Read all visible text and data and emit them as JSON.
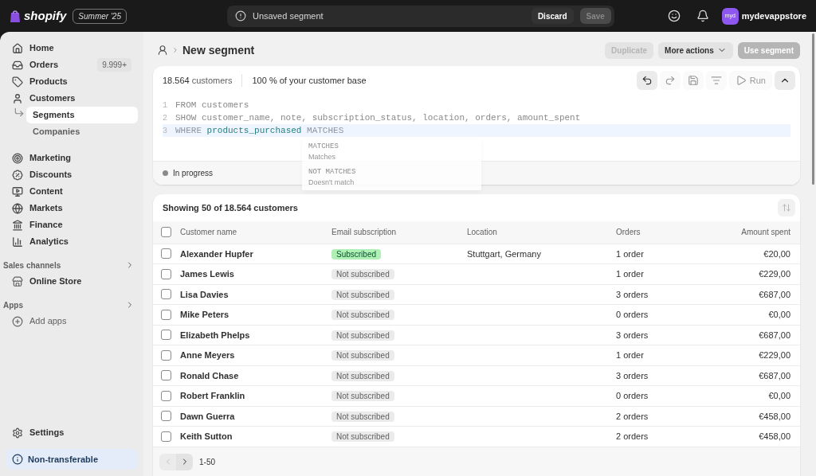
{
  "topbar": {
    "logo_text": "shopify",
    "edition_badge": "Summer '25",
    "notice": "Unsaved segment",
    "discard": "Discard",
    "save": {
      "label": "Save",
      "disabled": true
    },
    "avatar": "myd",
    "store_name": "mydevappstore"
  },
  "sidebar": {
    "items": [
      {
        "label": "Home",
        "selected": false,
        "sub": false
      },
      {
        "label": "Orders",
        "badge": "9.999+",
        "selected": false,
        "sub": false
      },
      {
        "label": "Products",
        "selected": false,
        "sub": false
      },
      {
        "label": "Customers",
        "selected": false,
        "sub": false
      },
      {
        "label": "Segments",
        "selected": true,
        "sub": true
      },
      {
        "label": "Companies",
        "selected": false,
        "sub": true
      },
      {
        "label": "Marketing",
        "selected": false,
        "sub": false
      },
      {
        "label": "Discounts",
        "selected": false,
        "sub": false
      },
      {
        "label": "Content",
        "selected": false,
        "sub": false
      },
      {
        "label": "Markets",
        "selected": false,
        "sub": false
      },
      {
        "label": "Finance",
        "selected": false,
        "sub": false
      },
      {
        "label": "Analytics",
        "selected": false,
        "sub": false
      }
    ],
    "sections": [
      {
        "title": "Sales channels",
        "items": [
          "Online Store"
        ]
      },
      {
        "title": "Apps",
        "items": [
          "Add apps"
        ]
      }
    ],
    "settings": "Settings",
    "plan_banner": "Non-transferable"
  },
  "page": {
    "title": "New segment",
    "actions": [
      {
        "label": "Duplicate",
        "disabled": true,
        "kind": "plain"
      },
      {
        "label": "More actions",
        "disabled": false,
        "kind": "menu"
      },
      {
        "label": "Use segment",
        "disabled": true,
        "kind": "primary"
      }
    ]
  },
  "editor": {
    "count_number": "18.564",
    "count_label": "customers",
    "share": "100 % of your customer base",
    "tools": [
      {
        "kind": "undo",
        "disabled": false
      },
      {
        "kind": "redo",
        "disabled": true
      },
      {
        "kind": "save",
        "disabled": true
      },
      {
        "kind": "filter",
        "disabled": true
      },
      {
        "kind": "run",
        "label": "Run",
        "disabled": true
      },
      {
        "kind": "collapse",
        "disabled": false
      }
    ],
    "lines": [
      {
        "number": "1",
        "active": false,
        "tokens": [
          {
            "text": "FROM customers",
            "kind": "plain"
          }
        ]
      },
      {
        "number": "2",
        "active": false,
        "tokens": [
          {
            "text": "SHOW customer_name, note, subscription_status, location, orders, amount_spent",
            "kind": "plain"
          }
        ]
      },
      {
        "number": "3",
        "active": true,
        "tokens": [
          {
            "text": "WHERE",
            "kind": "faded"
          },
          {
            "text": "products_purchased",
            "kind": "field"
          },
          {
            "text": "MATCHES",
            "kind": "faded"
          }
        ]
      }
    ],
    "suggestions": [
      {
        "label": "MATCHES",
        "description": "Matches"
      },
      {
        "label": "NOT MATCHES",
        "description": "Doesn't match"
      }
    ],
    "status": "In progress"
  },
  "results": {
    "summary": "Showing 50 of 18.564 customers",
    "select_all_checked": false,
    "columns": [
      "Customer name",
      "Email subscription",
      "Location",
      "Orders",
      "Amount spent"
    ],
    "rows": [
      {
        "checked": false,
        "name": "Alexander Hupfer",
        "subscription": "Subscribed",
        "subscribed": true,
        "location": "Stuttgart, Germany",
        "orders": "1 order",
        "amount": "€20,00"
      },
      {
        "checked": false,
        "name": "James Lewis",
        "subscription": "Not subscribed",
        "subscribed": false,
        "orders": "1 order",
        "amount": "€229,00"
      },
      {
        "checked": false,
        "name": "Lisa Davies",
        "subscription": "Not subscribed",
        "subscribed": false,
        "orders": "3 orders",
        "amount": "€687,00"
      },
      {
        "checked": false,
        "name": "Mike Peters",
        "subscription": "Not subscribed",
        "subscribed": false,
        "orders": "0 orders",
        "amount": "€0,00"
      },
      {
        "checked": false,
        "name": "Elizabeth Phelps",
        "subscription": "Not subscribed",
        "subscribed": false,
        "orders": "3 orders",
        "amount": "€687,00"
      },
      {
        "checked": false,
        "name": "Anne Meyers",
        "subscription": "Not subscribed",
        "subscribed": false,
        "orders": "1 order",
        "amount": "€229,00"
      },
      {
        "checked": false,
        "name": "Ronald Chase",
        "subscription": "Not subscribed",
        "subscribed": false,
        "orders": "3 orders",
        "amount": "€687,00"
      },
      {
        "checked": false,
        "name": "Robert Franklin",
        "subscription": "Not subscribed",
        "subscribed": false,
        "orders": "0 orders",
        "amount": "€0,00"
      },
      {
        "checked": false,
        "name": "Dawn Guerra",
        "subscription": "Not subscribed",
        "subscribed": false,
        "orders": "2 orders",
        "amount": "€458,00"
      },
      {
        "checked": false,
        "name": "Keith Sutton",
        "subscription": "Not subscribed",
        "subscribed": false,
        "orders": "2 orders",
        "amount": "€458,00"
      }
    ],
    "pagination": {
      "range": "1-50",
      "previous_disabled": true,
      "next_disabled": false
    }
  }
}
